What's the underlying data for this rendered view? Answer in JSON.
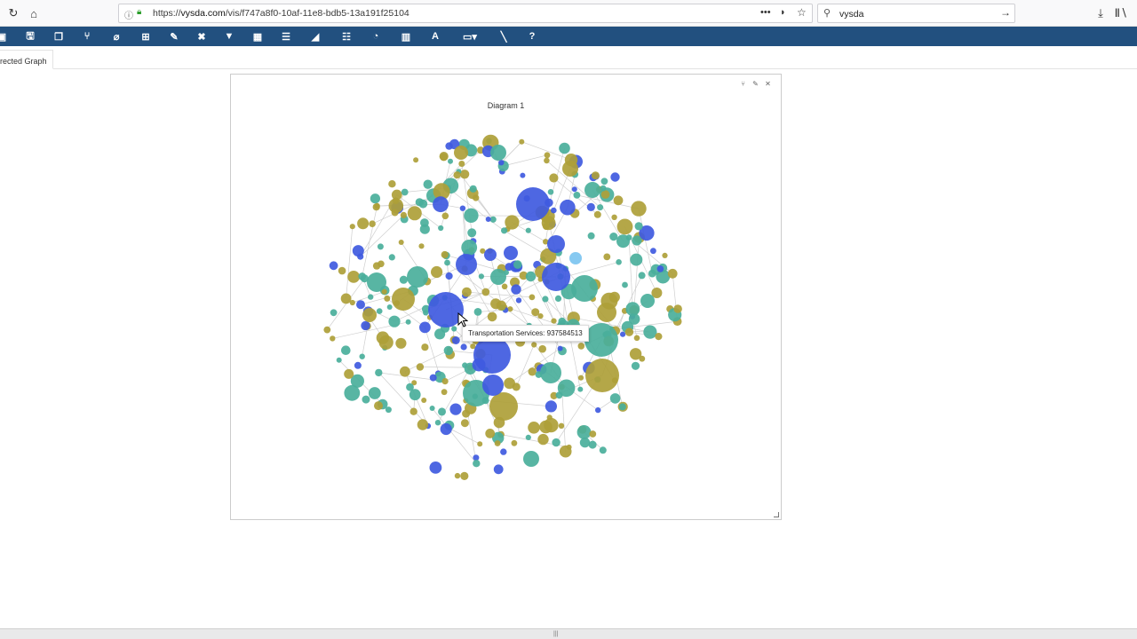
{
  "browser": {
    "url_prefix": "https://",
    "url_domain": "vysda.com",
    "url_path": "/vis/f747a8f0-10af-11e8-bdb5-13a191f25104",
    "search_value": "vysda"
  },
  "tabs": [
    {
      "label": "rected Graph"
    }
  ],
  "panel": {
    "title": "Diagram 1",
    "tooltip": "Transportation Services: 937584513"
  },
  "graph": {
    "type": "network",
    "colors": {
      "blue": "#3f5ae0",
      "teal": "#4aaf9b",
      "olive": "#aea038",
      "light": "#7cc4f0",
      "edge": "#cfcfcf"
    },
    "node_count": 400
  }
}
